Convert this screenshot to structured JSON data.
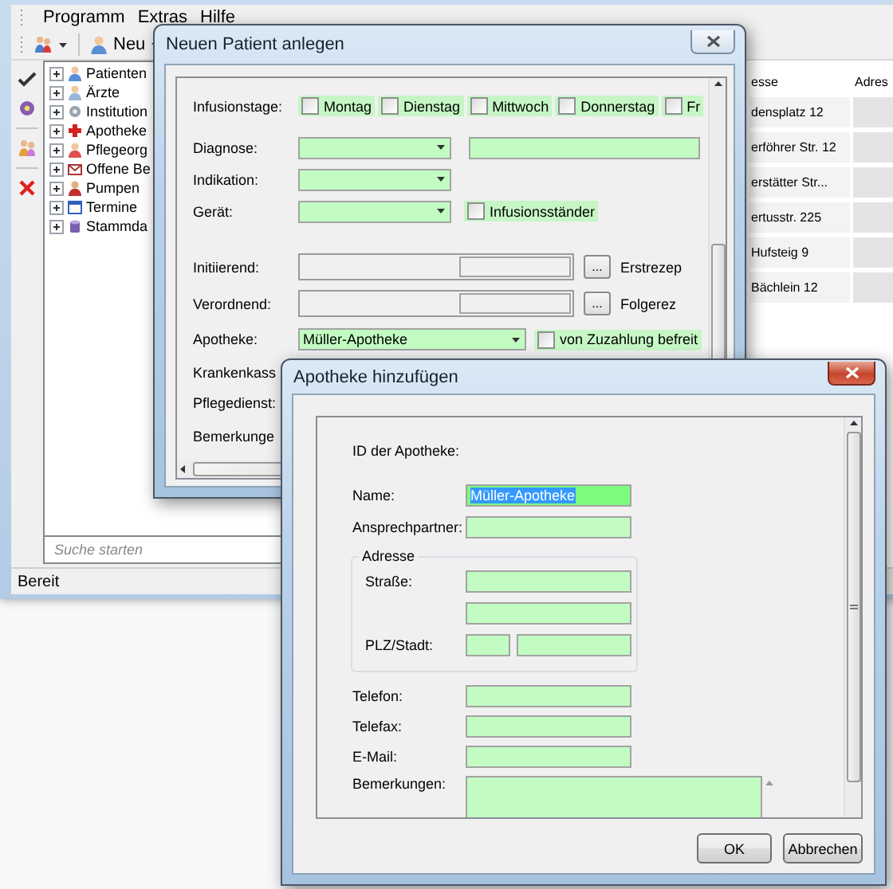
{
  "main_window": {
    "menu": [
      {
        "label": "Programm"
      },
      {
        "label": "Extras"
      },
      {
        "label": "Hilfe"
      }
    ],
    "toolbar": {
      "new_button": "Neu"
    },
    "tree": [
      {
        "label": "Patienten",
        "expanded": false
      },
      {
        "label": "Ärzte",
        "expanded": false
      },
      {
        "label": "Institution",
        "expanded": false
      },
      {
        "label": "Apotheke",
        "expanded": false
      },
      {
        "label": "Pflegeorg",
        "expanded": false
      },
      {
        "label": "Offene Be",
        "expanded": false
      },
      {
        "label": "Pumpen",
        "expanded": false
      },
      {
        "label": "Termine",
        "expanded": false
      },
      {
        "label": "Stammda",
        "expanded": false
      }
    ],
    "search": {
      "placeholder": "Suche starten"
    },
    "table": {
      "columns": [
        "esse",
        "Adres"
      ],
      "rows": [
        "densplatz 12",
        "erföhrer Str. 12",
        "erstätter Str...",
        "ertusstr. 225",
        "Hufsteig 9",
        "Bächlein 12"
      ]
    },
    "status_bar": "Bereit"
  },
  "patient_dialog": {
    "title": "Neuen Patient anlegen",
    "infusion_days": {
      "label": "Infusionstage:",
      "days": [
        {
          "label": "Montag",
          "checked": false
        },
        {
          "label": "Dienstag",
          "checked": false
        },
        {
          "label": "Mittwoch",
          "checked": false
        },
        {
          "label": "Donnerstag",
          "checked": false
        },
        {
          "label": "Fr",
          "checked": false
        }
      ]
    },
    "diagnose": {
      "label": "Diagnose:"
    },
    "indikation": {
      "label": "Indikation:"
    },
    "geraet": {
      "label": "Gerät:",
      "stand": {
        "label": "Infusionsständer",
        "checked": false
      }
    },
    "initiierend": {
      "label": "Initiierend:",
      "button": "...",
      "side_label": "Erstrezep"
    },
    "verordnend": {
      "label": "Verordnend:",
      "button": "...",
      "side_label": "Folgerez"
    },
    "apotheke": {
      "label": "Apotheke:",
      "value": "Müller-Apotheke",
      "exempt": {
        "label": "von Zuzahlung befreit",
        "checked": false
      }
    },
    "krankenkasse_label": "Krankenkass",
    "pflegedienst_label": "Pflegedienst:",
    "bemerkungen_label": "Bemerkunge"
  },
  "pharmacy_dialog": {
    "title": "Apotheke hinzufügen",
    "id_label": "ID der Apotheke:",
    "fields": [
      {
        "label": "Name:",
        "value": "Müller-Apotheke",
        "highlighted": true
      },
      {
        "label": "Ansprechpartner:",
        "highlighted": false
      }
    ],
    "address": {
      "legend": "Adresse",
      "street_label": "Straße:",
      "city_label": "PLZ/Stadt:"
    },
    "contact_fields": [
      {
        "label": "Telefon:"
      },
      {
        "label": "Telefax:"
      },
      {
        "label": "E-Mail:"
      }
    ],
    "remarks_label": "Bemerkungen:",
    "buttons": [
      "OK",
      "Abbrechen"
    ]
  }
}
